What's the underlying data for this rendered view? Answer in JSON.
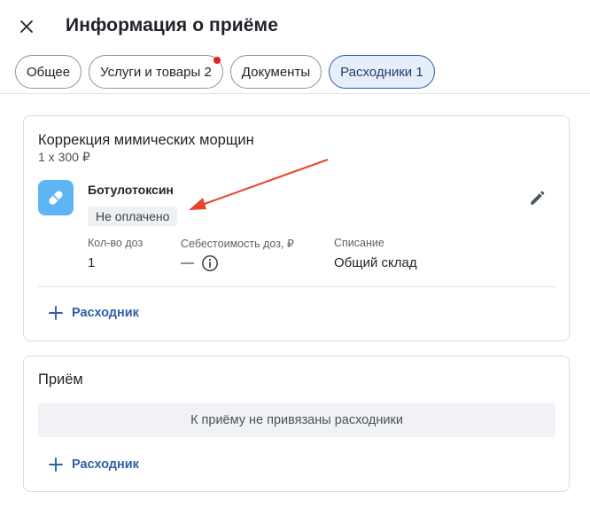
{
  "header": {
    "title": "Информация о приёме",
    "close_icon": "close-icon"
  },
  "tabs": [
    {
      "label": "Общее",
      "active": false,
      "has_dot": false
    },
    {
      "label": "Услуги и товары 2",
      "active": false,
      "has_dot": true
    },
    {
      "label": "Документы",
      "active": false,
      "has_dot": false
    },
    {
      "label": "Расходники 1",
      "active": true,
      "has_dot": false
    }
  ],
  "service": {
    "title": "Коррекция мимических морщин",
    "price": "1 x 300 ₽",
    "consumable": {
      "icon": "pill-icon",
      "name": "Ботулотоксин",
      "status": "Не оплачено",
      "columns": {
        "dose_count_label": "Кол-во доз",
        "dose_count_value": "1",
        "cost_label": "Себестоимость доз, ₽",
        "cost_value": "—",
        "writeoff_label": "Списание",
        "writeoff_value": "Общий склад"
      }
    },
    "add_label": "Расходник"
  },
  "appointment": {
    "title": "Приём",
    "empty_text": "К приёму не привязаны расходники",
    "add_label": "Расходник"
  },
  "colors": {
    "accent": "#2e5fa8",
    "active_tab_bg": "#e6eefa",
    "notification_dot": "#e32222",
    "pill_bg": "#5db5f5",
    "annotation_arrow": "#e8432b"
  }
}
